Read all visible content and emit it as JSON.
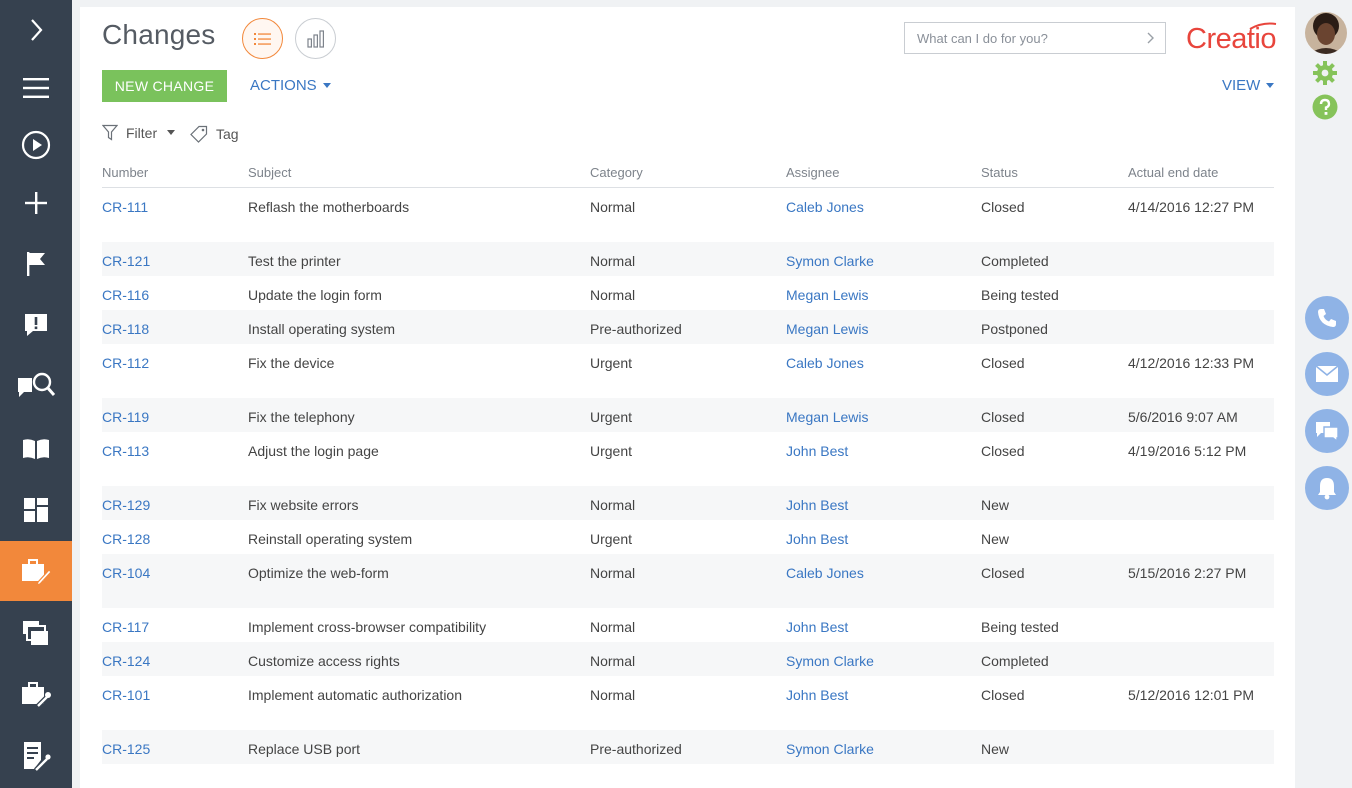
{
  "page": {
    "title": "Changes"
  },
  "toolbar": {
    "new_button": "NEW CHANGE",
    "actions_label": "ACTIONS",
    "view_label": "VIEW",
    "filter_label": "Filter",
    "tag_label": "Tag"
  },
  "search": {
    "placeholder": "What can I do for you?"
  },
  "logo": {
    "text": "Creatio"
  },
  "colors": {
    "accent": "#f2883b",
    "sidebar": "#36414f",
    "link": "#3a77c3",
    "primary_button": "#7ac25c",
    "brand": "#e8453c"
  },
  "sidebar_icons": [
    "chevron-right-icon",
    "hamburger-icon",
    "play-icon",
    "plus-icon",
    "flag-icon",
    "alert-icon",
    "knowledge-search-icon",
    "book-icon",
    "dashboard-icon",
    "changes-icon",
    "releases-icon",
    "services-icon",
    "document-edit-icon"
  ],
  "grid": {
    "columns": [
      "Number",
      "Subject",
      "Category",
      "Assignee",
      "Status",
      "Actual end date"
    ],
    "rows": [
      {
        "number": "CR-111",
        "subject": "Reflash the motherboards",
        "category": "Normal",
        "assignee": "Caleb Jones",
        "status": "Closed",
        "end_date": "4/14/2016 12:27 PM"
      },
      {
        "number": "CR-121",
        "subject": "Test the printer",
        "category": "Normal",
        "assignee": "Symon Clarke",
        "status": "Completed",
        "end_date": ""
      },
      {
        "number": "CR-116",
        "subject": "Update the login form",
        "category": "Normal",
        "assignee": "Megan Lewis",
        "status": "Being tested",
        "end_date": ""
      },
      {
        "number": "CR-118",
        "subject": "Install operating system",
        "category": "Pre-authorized",
        "assignee": "Megan Lewis",
        "status": "Postponed",
        "end_date": ""
      },
      {
        "number": "CR-112",
        "subject": "Fix the device",
        "category": "Urgent",
        "assignee": "Caleb Jones",
        "status": "Closed",
        "end_date": "4/12/2016 12:33 PM"
      },
      {
        "number": "CR-119",
        "subject": "Fix the telephony",
        "category": "Urgent",
        "assignee": "Megan Lewis",
        "status": "Closed",
        "end_date": "5/6/2016 9:07 AM"
      },
      {
        "number": "CR-113",
        "subject": "Adjust the login page",
        "category": "Urgent",
        "assignee": "John Best",
        "status": "Closed",
        "end_date": "4/19/2016 5:12 PM"
      },
      {
        "number": "CR-129",
        "subject": "Fix website errors",
        "category": "Normal",
        "assignee": "John Best",
        "status": "New",
        "end_date": ""
      },
      {
        "number": "CR-128",
        "subject": "Reinstall operating system",
        "category": "Urgent",
        "assignee": "John Best",
        "status": "New",
        "end_date": ""
      },
      {
        "number": "CR-104",
        "subject": "Optimize the web-form",
        "category": "Normal",
        "assignee": "Caleb Jones",
        "status": "Closed",
        "end_date": "5/15/2016 2:27 PM"
      },
      {
        "number": "CR-117",
        "subject": "Implement cross-browser compatibility",
        "category": "Normal",
        "assignee": "John Best",
        "status": "Being tested",
        "end_date": ""
      },
      {
        "number": "CR-124",
        "subject": "Customize access rights",
        "category": "Normal",
        "assignee": "Symon Clarke",
        "status": "Completed",
        "end_date": ""
      },
      {
        "number": "CR-101",
        "subject": "Implement automatic authorization",
        "category": "Normal",
        "assignee": "John Best",
        "status": "Closed",
        "end_date": "5/12/2016 12:01 PM"
      },
      {
        "number": "CR-125",
        "subject": "Replace USB port",
        "category": "Pre-authorized",
        "assignee": "Symon Clarke",
        "status": "New",
        "end_date": ""
      }
    ]
  },
  "rail_icons": [
    "user-avatar",
    "gear-icon",
    "help-icon",
    "phone-icon",
    "email-icon",
    "chat-icon",
    "bell-icon"
  ]
}
